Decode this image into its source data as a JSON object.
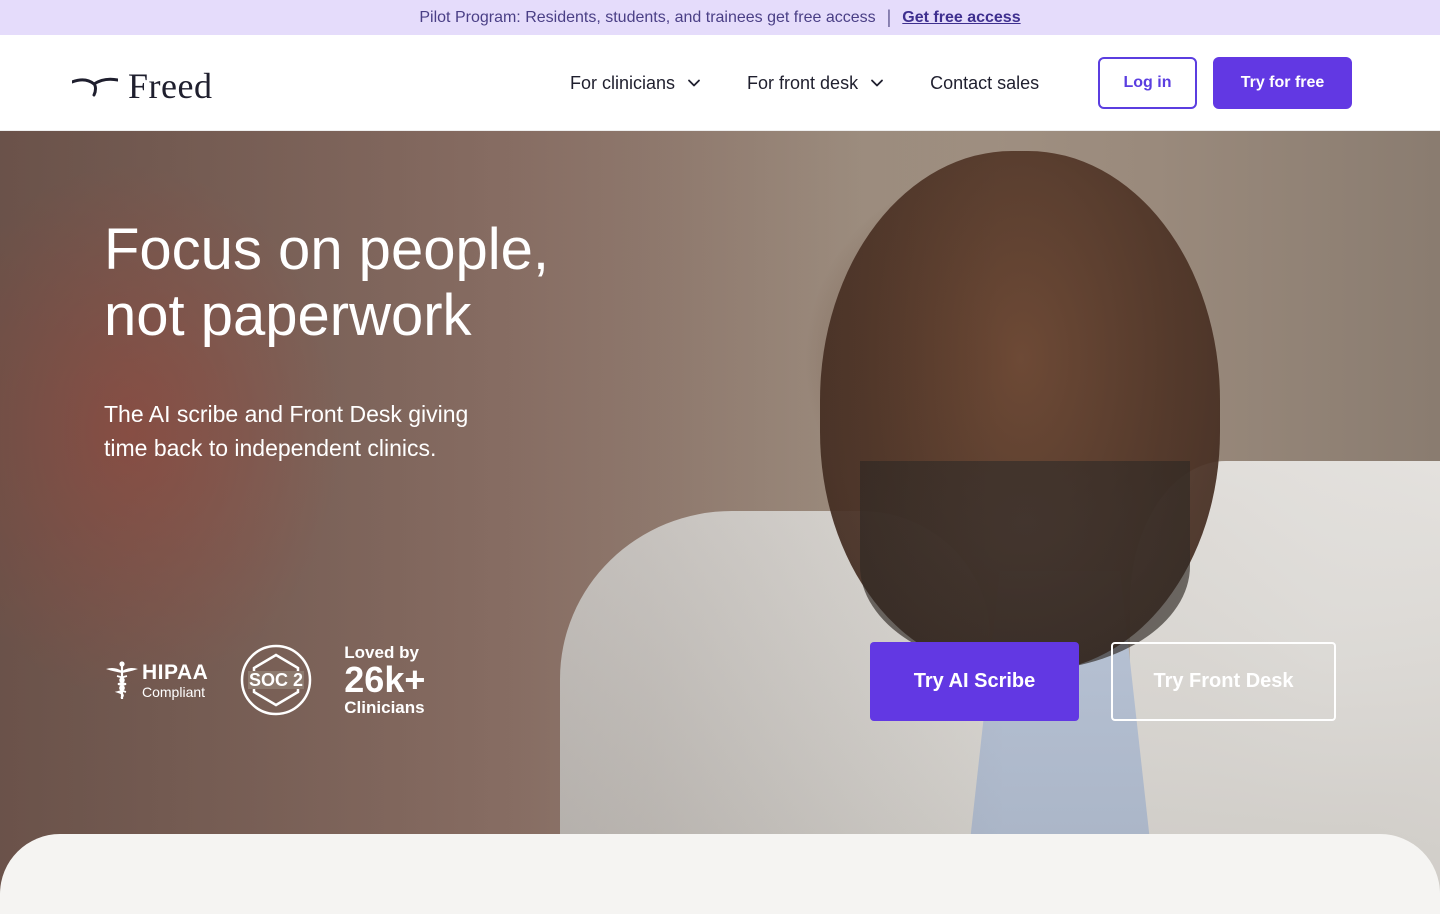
{
  "announcement": {
    "text": "Pilot Program: Residents, students, and trainees get free access",
    "separator": "|",
    "link_label": "Get free access"
  },
  "header": {
    "logo_text": "Freed",
    "nav": [
      {
        "label": "For clinicians",
        "has_dropdown": true,
        "icon": "chevron-down-icon"
      },
      {
        "label": "For front desk",
        "has_dropdown": true,
        "icon": "chevron-down-icon"
      },
      {
        "label": "Contact sales",
        "has_dropdown": false
      }
    ],
    "login_label": "Log in",
    "try_label": "Try for free"
  },
  "hero": {
    "title_line1": "Focus on people,",
    "title_line2": "not paperwork",
    "subtitle_line1": "The AI scribe and Front Desk giving",
    "subtitle_line2": "time back to independent clinics.",
    "badges": {
      "hipaa_title": "HIPAA",
      "hipaa_sub": "Compliant",
      "soc_label": "SOC 2",
      "loved_line1": "Loved by",
      "loved_count": "26k+",
      "loved_line3": "Clinicians"
    },
    "cta_primary": "Try AI Scribe",
    "cta_secondary": "Try Front Desk"
  },
  "colors": {
    "brand": "#6238e3",
    "announcement_bg": "#e5dcfb"
  }
}
